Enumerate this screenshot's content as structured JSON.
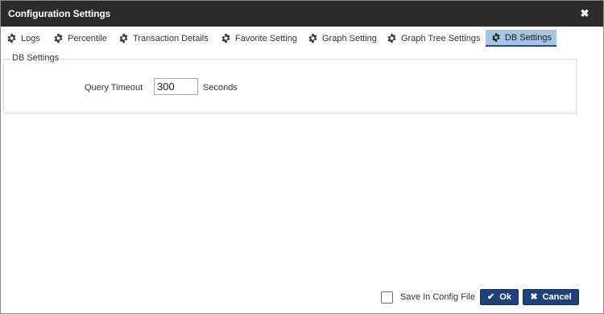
{
  "window": {
    "title": "Configuration Settings",
    "close_icon": "close-icon"
  },
  "tabs": [
    {
      "label": "Logs",
      "icon": "gear-icon",
      "active": false
    },
    {
      "label": "Percentile",
      "icon": "gear-icon",
      "active": false
    },
    {
      "label": "Transaction Details",
      "icon": "gear-icon",
      "active": false
    },
    {
      "label": "Favorite Setting",
      "icon": "gear-icon",
      "active": false
    },
    {
      "label": "Graph Setting",
      "icon": "gear-icon",
      "active": false
    },
    {
      "label": "Graph Tree Settings",
      "icon": "gear-icon",
      "active": false
    },
    {
      "label": "DB Settings",
      "icon": "gear-icon",
      "active": true
    }
  ],
  "db_settings": {
    "legend": "DB Settings",
    "query_timeout_label": "Query Timeout",
    "query_timeout_value": "300",
    "unit_label": "Seconds"
  },
  "footer": {
    "save_in_config_label": "Save In Config File",
    "save_in_config_checked": false,
    "ok_label": "Ok",
    "cancel_label": "Cancel"
  },
  "colors": {
    "titlebar": "#2b2b2b",
    "active_tab_bg": "#a7c4e6",
    "active_tab_border": "#244d8a",
    "button_bg": "#1e4179"
  }
}
